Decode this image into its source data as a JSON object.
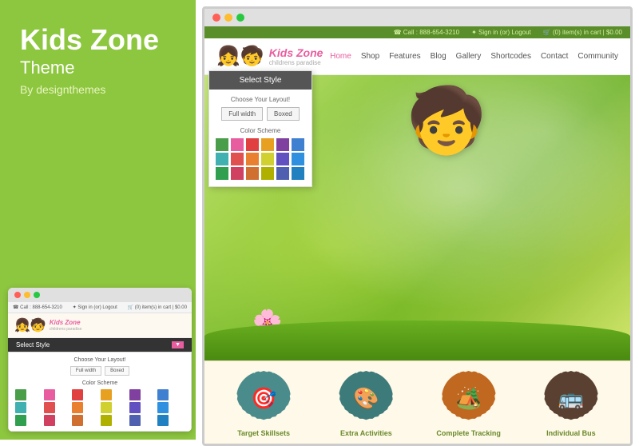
{
  "left": {
    "title": "Kids Zone",
    "subtitle": "Theme",
    "by": "By designthemes"
  },
  "mini": {
    "dots": [
      "red",
      "yellow",
      "green"
    ],
    "topbar": {
      "call": "☎ Call : 888-654-3210",
      "signin": "✦ Sign in (or) Logout",
      "cart": "🛒 (0) item(s) in cart | $0.00"
    },
    "logo_text": "Kids Zone",
    "logo_tagline": "childrens paradise",
    "select_style_btn": "Select Style",
    "layout_title": "Choose Your Layout!",
    "layout_options": [
      "Full width",
      "Boxed"
    ],
    "color_title": "Color Scheme",
    "colors": [
      "#4a9e4a",
      "#e85d9f",
      "#e04040",
      "#e8a020",
      "#8040a0",
      "#4080d0",
      "#40b0b0",
      "#e05050",
      "#e88030",
      "#d0d030",
      "#6050c0",
      "#3090e0",
      "#30a050",
      "#d04060",
      "#d07030",
      "#b0b000",
      "#5060b0",
      "#2080c0"
    ]
  },
  "browser": {
    "dots": [
      "red",
      "yellow",
      "green"
    ],
    "topbar": {
      "call": "☎ Call : 888-654-3210",
      "signin": "✦ Sign in (or) Logout",
      "cart": "🛒 (0) item(s) in cart | $0.00"
    },
    "logo_text": "Kids Zone",
    "logo_tagline": "childrens paradise",
    "nav": [
      "Home",
      "Shop",
      "Features",
      "Blog",
      "Gallery",
      "Shortcodes",
      "Contact",
      "Community"
    ],
    "active_nav": "Home"
  },
  "select_style": {
    "header": "Select Style",
    "layout_title": "Choose Your Layout!",
    "layout_options": [
      "Full width",
      "Boxed"
    ],
    "color_title": "Color Scheme",
    "colors": [
      "#4a9e4a",
      "#e85d9f",
      "#e04040",
      "#e8a020",
      "#8040a0",
      "#4080d0",
      "#40b0b0",
      "#e05050",
      "#e88030",
      "#d0d030",
      "#6050c0",
      "#3090e0",
      "#30a050",
      "#d04060",
      "#d07030",
      "#b0b000",
      "#5060b0",
      "#2080c0"
    ]
  },
  "features": [
    {
      "label": "Target Skillsets",
      "icon": "🎯",
      "color": "#4a8c8c"
    },
    {
      "label": "Extra Activities",
      "icon": "🎨",
      "color": "#3d7a7a"
    },
    {
      "label": "Complete Tracking",
      "icon": "🏕️",
      "color": "#c06820"
    },
    {
      "label": "Individual Bus",
      "icon": "🚌",
      "color": "#5a4030"
    }
  ],
  "hero": {
    "girl": "👧",
    "flower": "🌸"
  }
}
